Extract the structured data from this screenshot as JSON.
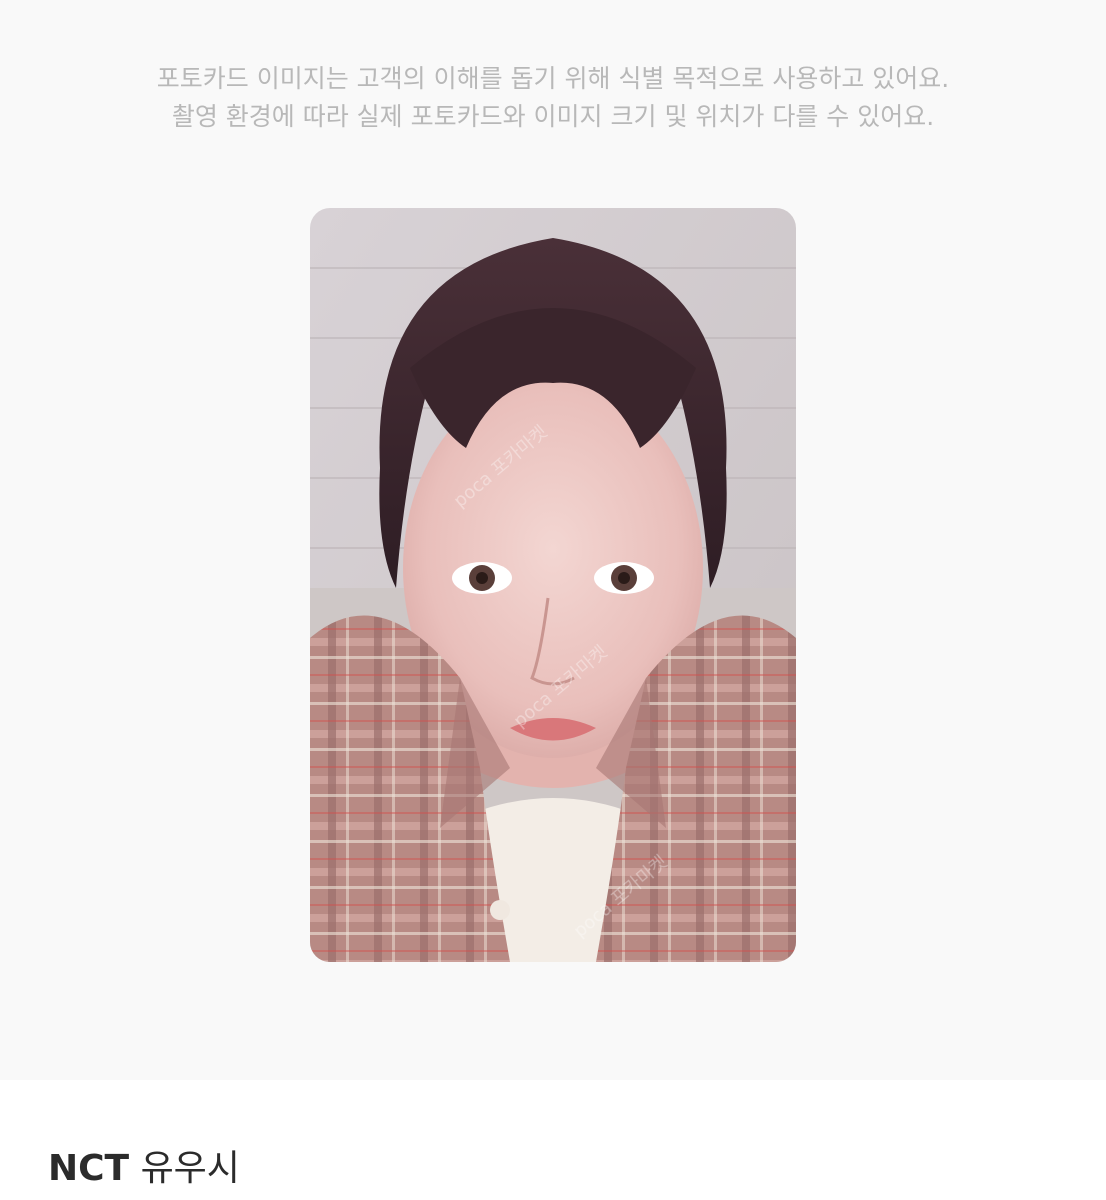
{
  "notice": {
    "line1": "포토카드 이미지는 고객의 이해를 돕기 위해 식별 목적으로 사용하고 있어요.",
    "line2": "촬영 환경에 따라 실제 포토카드와 이미지 크기 및 위치가 다를 수 있어요."
  },
  "product": {
    "group": "NCT",
    "member": "유우시"
  },
  "photocard": {
    "subject": "member selfie photocard",
    "watermark": "poca 포카마켓"
  },
  "colors": {
    "viewer_bg": "#f9f9f9",
    "notice_text": "#b8b8b8",
    "title_text": "#2b2b2b"
  }
}
